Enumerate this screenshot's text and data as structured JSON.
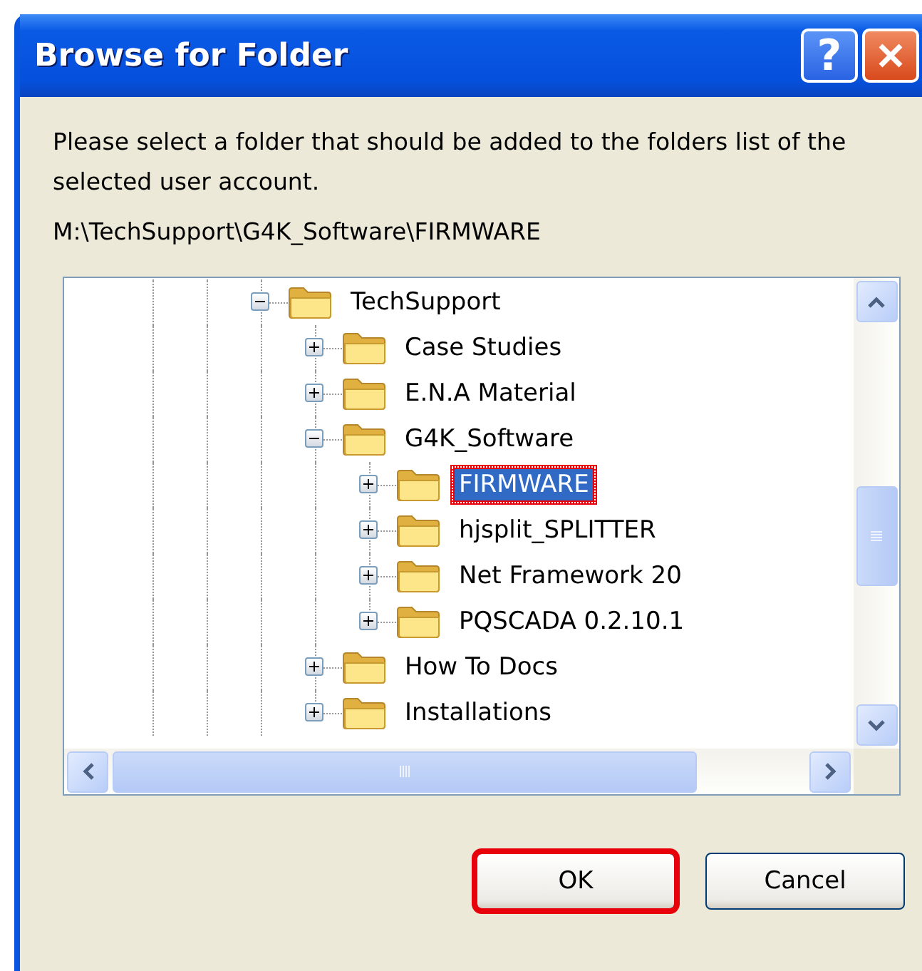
{
  "window": {
    "title": "Browse for Folder"
  },
  "title_buttons": [
    {
      "kind": "help",
      "label": "?"
    },
    {
      "kind": "close"
    }
  ],
  "instructions": "Please select a folder that should be added to the folders list of the selected user account.",
  "path": "M:\\TechSupport\\G4K_Software\\FIRMWARE",
  "tree": [
    {
      "label": "TechSupport",
      "expanded": true,
      "selected": false,
      "highlighted": false,
      "children": [
        {
          "label": "Case Studies",
          "expanded": false,
          "selected": false,
          "highlighted": false
        },
        {
          "label": "E.N.A Material",
          "expanded": false,
          "selected": false,
          "highlighted": false
        },
        {
          "label": "G4K_Software",
          "expanded": true,
          "selected": false,
          "highlighted": false,
          "children": [
            {
              "label": "FIRMWARE",
              "expanded": false,
              "selected": true,
              "highlighted": true
            },
            {
              "label": "hjsplit_SPLITTER",
              "expanded": false,
              "selected": false,
              "highlighted": false
            },
            {
              "label": "Net Framework 20",
              "expanded": false,
              "selected": false,
              "highlighted": false
            },
            {
              "label": "PQSCADA 0.2.10.1",
              "expanded": false,
              "selected": false,
              "highlighted": false
            }
          ]
        },
        {
          "label": "How To Docs",
          "expanded": false,
          "selected": false,
          "highlighted": false
        },
        {
          "label": "Installations",
          "expanded": false,
          "selected": false,
          "highlighted": false
        }
      ]
    }
  ],
  "buttons": [
    {
      "label": "OK",
      "highlighted": true
    },
    {
      "label": "Cancel",
      "highlighted": false
    }
  ]
}
